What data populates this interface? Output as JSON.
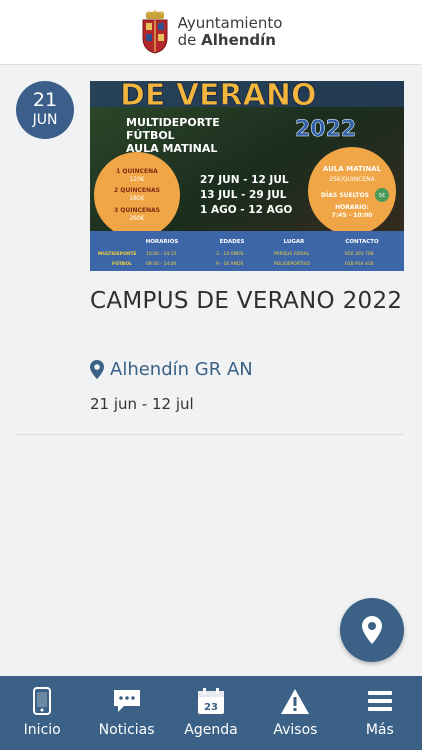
{
  "header": {
    "line1": "Ayuntamiento",
    "line2_prefix": "de ",
    "line2_bold": "Alhendín"
  },
  "event": {
    "day": "21",
    "month": "JUN",
    "title": "CAMPUS DE VERANO 2022",
    "location": "Alhendín GR AN",
    "dates": "21 jun - 12 jul",
    "poster": {
      "heading": "DE VERANO",
      "year": "2022",
      "lines": [
        "MULTIDEPORTE",
        "FÚTBOL",
        "AULA MATINAL"
      ],
      "quincenas": [
        "1 QUINCENA",
        "120€",
        "2 QUINCENAS",
        "180€",
        "3 QUINCENAS",
        "260€"
      ],
      "periods": [
        "27 JUN - 12 JUL",
        "13 JUL - 29 JUL",
        "1 AGO - 12 AGO"
      ],
      "aula": [
        "AULA MATINAL",
        "25€/QUINCENA",
        "DÍAS SUELTOS",
        "5€",
        "HORARIO:",
        "7:45 - 10:00"
      ],
      "table_headers": [
        "HORARIOS",
        "EDADES",
        "LUGAR",
        "CONTACTO"
      ],
      "table_rows": [
        [
          "MULTIDEPORTE",
          "10:00 - 14:15",
          "3 - 14 AÑOS",
          "PARQUE FERIAL",
          "650 301 708"
        ],
        [
          "FÚTBOL",
          "09:30 - 14:00",
          "9 - 16 AÑOS",
          "POLIDEPORTIVO",
          "618 934 418"
        ]
      ]
    }
  },
  "nav": [
    {
      "label": "Inicio",
      "icon": "phone-icon"
    },
    {
      "label": "Noticias",
      "icon": "chat-icon"
    },
    {
      "label": "Agenda",
      "icon": "calendar-icon",
      "calendar_number": "23"
    },
    {
      "label": "Avisos",
      "icon": "warning-icon"
    },
    {
      "label": "Más",
      "icon": "menu-icon"
    }
  ],
  "colors": {
    "primary": "#3b6286",
    "badge": "#3b5f8a",
    "poster_orange": "#f0a646",
    "poster_yellow": "#f3d23a"
  }
}
